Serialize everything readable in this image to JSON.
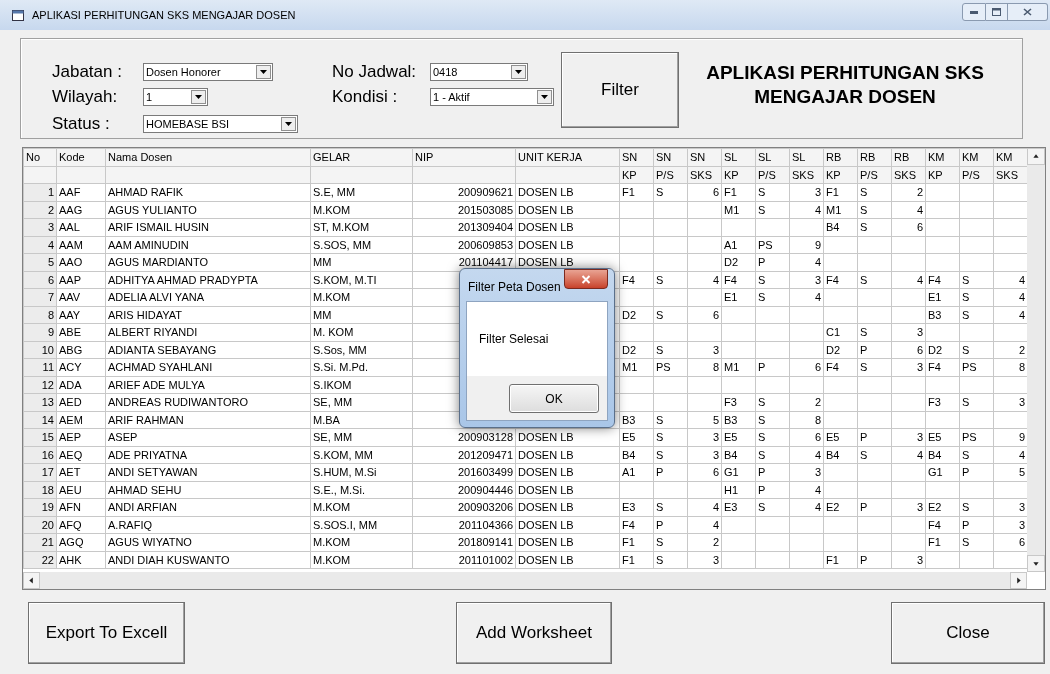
{
  "window": {
    "title": "APLIKASI PERHITUNGAN SKS MENGAJAR DOSEN"
  },
  "filters_left": [
    {
      "label": "Jabatan :",
      "value": "Dosen Honorer"
    },
    {
      "label": "Wilayah:",
      "value": "1"
    },
    {
      "label": "Status :",
      "value": "HOMEBASE BSI"
    }
  ],
  "filters_right": [
    {
      "label": "No Jadwal:",
      "value": "0418"
    },
    {
      "label": "Kondisi :",
      "value": "1 - Aktif"
    }
  ],
  "filter_button": "Filter",
  "app_heading": "APLIKASI PERHITUNGAN SKS MENGAJAR DOSEN",
  "table": {
    "columns": [
      {
        "label": "No"
      },
      {
        "label": "Kode"
      },
      {
        "label": "Nama Dosen"
      },
      {
        "label": "GELAR"
      },
      {
        "label": "NIP"
      },
      {
        "label": "UNIT KERJA"
      },
      {
        "label": "SN",
        "sub": "KP"
      },
      {
        "label": "SN",
        "sub": "P/S"
      },
      {
        "label": "SN",
        "sub": "SKS"
      },
      {
        "label": "SL",
        "sub": "KP"
      },
      {
        "label": "SL",
        "sub": "P/S"
      },
      {
        "label": "SL",
        "sub": "SKS"
      },
      {
        "label": "RB",
        "sub": "KP"
      },
      {
        "label": "RB",
        "sub": "P/S"
      },
      {
        "label": "RB",
        "sub": "SKS"
      },
      {
        "label": "KM",
        "sub": "KP"
      },
      {
        "label": "KM",
        "sub": "P/S"
      },
      {
        "label": "KM",
        "sub": "SKS"
      }
    ],
    "rows": [
      {
        "no": "1",
        "kode": "AAF",
        "nama": "AHMAD RAFIK",
        "gelar": "S.E, MM",
        "nip": "200909621",
        "unit": "DOSEN LB",
        "sn": {
          "kp": "F1",
          "ps": "S",
          "sks": "6"
        },
        "sl": {
          "kp": "F1",
          "ps": "S",
          "sks": "3"
        },
        "rb": {
          "kp": "F1",
          "ps": "S",
          "sks": "2"
        }
      },
      {
        "no": "2",
        "kode": "AAG",
        "nama": "AGUS YULIANTO",
        "gelar": "M.KOM",
        "nip": "201503085",
        "unit": "DOSEN LB",
        "sl": {
          "kp": "M1",
          "ps": "S",
          "sks": "4"
        },
        "rb": {
          "kp": "M1",
          "ps": "S",
          "sks": "4"
        }
      },
      {
        "no": "3",
        "kode": "AAL",
        "nama": "ARIF ISMAIL HUSIN",
        "gelar": "ST, M.KOM",
        "nip": "201309404",
        "unit": "DOSEN LB",
        "rb": {
          "kp": "B4",
          "ps": "S",
          "sks": "6"
        }
      },
      {
        "no": "4",
        "kode": "AAM",
        "nama": "AAM AMINUDIN",
        "gelar": "S.SOS, MM",
        "nip": "200609853",
        "unit": "DOSEN LB",
        "sl": {
          "kp": "A1",
          "ps": "PS",
          "sks": "9"
        }
      },
      {
        "no": "5",
        "kode": "AAO",
        "nama": "AGUS MARDIANTO",
        "gelar": "MM",
        "nip": "201104417",
        "unit": "DOSEN LB",
        "sl": {
          "kp": "D2",
          "ps": "P",
          "sks": "4"
        }
      },
      {
        "no": "6",
        "kode": "AAP",
        "nama": "ADHITYA AHMAD PRADYPTA",
        "gelar": "S.KOM, M.TI",
        "sn": {
          "kp": "F4",
          "ps": "S",
          "sks": "4"
        },
        "sl": {
          "kp": "F4",
          "ps": "S",
          "sks": "3"
        },
        "rb": {
          "kp": "F4",
          "ps": "S",
          "sks": "4"
        },
        "km": {
          "kp": "F4",
          "ps": "S",
          "sks": "4"
        }
      },
      {
        "no": "7",
        "kode": "AAV",
        "nama": "ADELIA ALVI YANA",
        "gelar": "M.KOM",
        "sl": {
          "kp": "E1",
          "ps": "S",
          "sks": "4"
        },
        "km": {
          "kp": "E1",
          "ps": "S",
          "sks": "4"
        }
      },
      {
        "no": "8",
        "kode": "AAY",
        "nama": "ARIS HIDAYAT",
        "gelar": "MM",
        "sn": {
          "kp": "D2",
          "ps": "S",
          "sks": "6"
        },
        "km": {
          "kp": "B3",
          "ps": "S",
          "sks": "4"
        }
      },
      {
        "no": "9",
        "kode": "ABE",
        "nama": "ALBERT RIYANDI",
        "gelar": "M. KOM",
        "rb": {
          "kp": "C1",
          "ps": "S",
          "sks": "3"
        }
      },
      {
        "no": "10",
        "kode": "ABG",
        "nama": "ADIANTA SEBAYANG",
        "gelar": "S.Sos, MM",
        "sn": {
          "kp": "D2",
          "ps": "S",
          "sks": "3"
        },
        "rb": {
          "kp": "D2",
          "ps": "P",
          "sks": "6"
        },
        "km": {
          "kp": "D2",
          "ps": "S",
          "sks": "2"
        }
      },
      {
        "no": "11",
        "kode": "ACY",
        "nama": "ACHMAD SYAHLANI",
        "gelar": "S.Si. M.Pd.",
        "sn": {
          "kp": "M1",
          "ps": "PS",
          "sks": "8"
        },
        "sl": {
          "kp": "M1",
          "ps": "P",
          "sks": "6"
        },
        "rb": {
          "kp": "F4",
          "ps": "S",
          "sks": "3"
        },
        "km": {
          "kp": "F4",
          "ps": "PS",
          "sks": "8"
        }
      },
      {
        "no": "12",
        "kode": "ADA",
        "nama": "ARIEF ADE MULYA",
        "gelar": "S.IKOM"
      },
      {
        "no": "13",
        "kode": "AED",
        "nama": "ANDREAS RUDIWANTORO",
        "gelar": "SE, MM",
        "sl": {
          "kp": "F3",
          "ps": "S",
          "sks": "2"
        },
        "km": {
          "kp": "F3",
          "ps": "S",
          "sks": "3"
        }
      },
      {
        "no": "14",
        "kode": "AEM",
        "nama": "ARIF RAHMAN",
        "gelar": "M.BA",
        "sn": {
          "kp": "B3",
          "ps": "S",
          "sks": "5"
        },
        "sl": {
          "kp": "B3",
          "ps": "S",
          "sks": "8"
        }
      },
      {
        "no": "15",
        "kode": "AEP",
        "nama": "ASEP",
        "gelar": "SE, MM",
        "nip": "200903128",
        "unit": "DOSEN LB",
        "sn": {
          "kp": "E5",
          "ps": "S",
          "sks": "3"
        },
        "sl": {
          "kp": "E5",
          "ps": "S",
          "sks": "6"
        },
        "rb": {
          "kp": "E5",
          "ps": "P",
          "sks": "3"
        },
        "km": {
          "kp": "E5",
          "ps": "PS",
          "sks": "9"
        }
      },
      {
        "no": "16",
        "kode": "AEQ",
        "nama": "ADE PRIYATNA",
        "gelar": "S.KOM, MM",
        "nip": "201209471",
        "unit": "DOSEN LB",
        "sn": {
          "kp": "B4",
          "ps": "S",
          "sks": "3"
        },
        "sl": {
          "kp": "B4",
          "ps": "S",
          "sks": "4"
        },
        "rb": {
          "kp": "B4",
          "ps": "S",
          "sks": "4"
        },
        "km": {
          "kp": "B4",
          "ps": "S",
          "sks": "4"
        }
      },
      {
        "no": "17",
        "kode": "AET",
        "nama": "ANDI SETYAWAN",
        "gelar": "S.HUM, M.Si",
        "nip": "201603499",
        "unit": "DOSEN LB",
        "sn": {
          "kp": "A1",
          "ps": "P",
          "sks": "6"
        },
        "sl": {
          "kp": "G1",
          "ps": "P",
          "sks": "3"
        },
        "km": {
          "kp": "G1",
          "ps": "P",
          "sks": "5"
        }
      },
      {
        "no": "18",
        "kode": "AEU",
        "nama": "AHMAD SEHU",
        "gelar": "S.E., M.Si.",
        "nip": "200904446",
        "unit": "DOSEN LB",
        "sl": {
          "kp": "H1",
          "ps": "P",
          "sks": "4"
        }
      },
      {
        "no": "19",
        "kode": "AFN",
        "nama": "ANDI ARFIAN",
        "gelar": "M.KOM",
        "nip": "200903206",
        "unit": "DOSEN LB",
        "sn": {
          "kp": "E3",
          "ps": "S",
          "sks": "4"
        },
        "sl": {
          "kp": "E3",
          "ps": "S",
          "sks": "4"
        },
        "rb": {
          "kp": "E2",
          "ps": "P",
          "sks": "3"
        },
        "km": {
          "kp": "E2",
          "ps": "S",
          "sks": "3"
        }
      },
      {
        "no": "20",
        "kode": "AFQ",
        "nama": "A.RAFIQ",
        "gelar": "S.SOS.I, MM",
        "nip": "201104366",
        "unit": "DOSEN LB",
        "sn": {
          "kp": "F4",
          "ps": "P",
          "sks": "4"
        },
        "km": {
          "kp": "F4",
          "ps": "P",
          "sks": "3"
        }
      },
      {
        "no": "21",
        "kode": "AGQ",
        "nama": "AGUS WIYATNO",
        "gelar": "M.KOM",
        "nip": "201809141",
        "unit": "DOSEN LB",
        "sn": {
          "kp": "F1",
          "ps": "S",
          "sks": "2"
        },
        "km": {
          "kp": "F1",
          "ps": "S",
          "sks": "6"
        }
      },
      {
        "no": "22",
        "kode": "AHK",
        "nama": "ANDI DIAH KUSWANTO",
        "gelar": "M.KOM",
        "nip": "201101002",
        "unit": "DOSEN LB",
        "sn": {
          "kp": "F1",
          "ps": "S",
          "sks": "3"
        },
        "rb": {
          "kp": "F1",
          "ps": "P",
          "sks": "3"
        }
      }
    ]
  },
  "buttons": [
    "Export To Excell",
    "Add Worksheet",
    "Close"
  ],
  "dialog": {
    "title": "Filter Peta Dosen",
    "message": "Filter Selesai",
    "button": "OK"
  }
}
